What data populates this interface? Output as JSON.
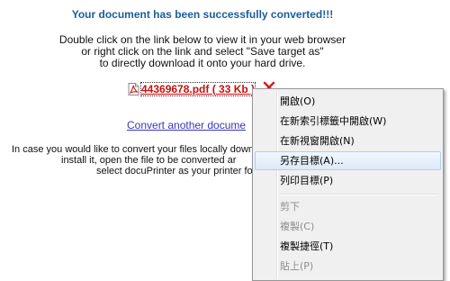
{
  "page": {
    "title": "Your document has been successfully converted!!!",
    "instructions": [
      "Double click on the link below to view it in your web browser",
      "or right click on the link and select \"Save target as\"",
      "to directly download it onto your hard drive."
    ],
    "file_link": "44369678.pdf ( 33 Kb )",
    "convert_another": "Convert another docume",
    "local_convert": [
      "In case you would like to convert your files locally down",
      "install it, open the file to be converted ar",
      "select docuPrinter as your printer fo"
    ],
    "icons": [
      "pdf-file-icon",
      "delete-x-icon"
    ],
    "colors": {
      "title": "#1b5e9b",
      "file_link": "#c41212",
      "convert_link": "#3a36b8",
      "delete_x": "#d42020"
    }
  },
  "context_menu": {
    "items": [
      {
        "label": "開啟(O)",
        "enabled": true,
        "selected": false
      },
      {
        "label": "在新索引標籤中開啟(W)",
        "enabled": true,
        "selected": false
      },
      {
        "label": "在新視窗開啟(N)",
        "enabled": true,
        "selected": false
      },
      {
        "label": "另存目標(A)...",
        "enabled": true,
        "selected": true
      },
      {
        "label": "列印目標(P)",
        "enabled": true,
        "selected": false
      },
      {
        "label": "剪下",
        "enabled": false,
        "selected": false
      },
      {
        "label": "複製(C)",
        "enabled": false,
        "selected": false
      },
      {
        "label": "複製捷徑(T)",
        "enabled": true,
        "selected": false
      },
      {
        "label": "貼上(P)",
        "enabled": false,
        "selected": false
      }
    ]
  }
}
